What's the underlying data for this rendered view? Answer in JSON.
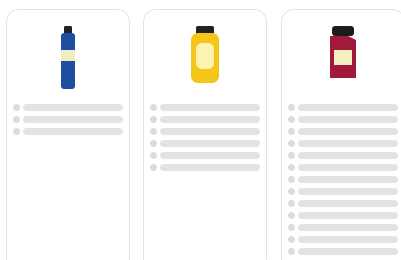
{
  "cards": [
    {
      "product_icon": "spray-can-icon",
      "colors": {
        "body": "#1f4ea1",
        "label": "#f1ecc4",
        "cap": "#222222"
      },
      "rows": 3
    },
    {
      "product_icon": "squeeze-bottle-icon",
      "colors": {
        "body": "#f5c518",
        "label": "#fdf2b0",
        "cap": "#222222"
      },
      "rows": 6
    },
    {
      "product_icon": "jar-icon",
      "colors": {
        "body": "#a11a3e",
        "label": "#f6efc0",
        "cap": "#1c1c1c"
      },
      "rows": 13
    }
  ],
  "placeholder_colors": {
    "dot": "#dcdcdc",
    "bar": "#e3e3e3",
    "card_border": "#e3e3e3"
  }
}
